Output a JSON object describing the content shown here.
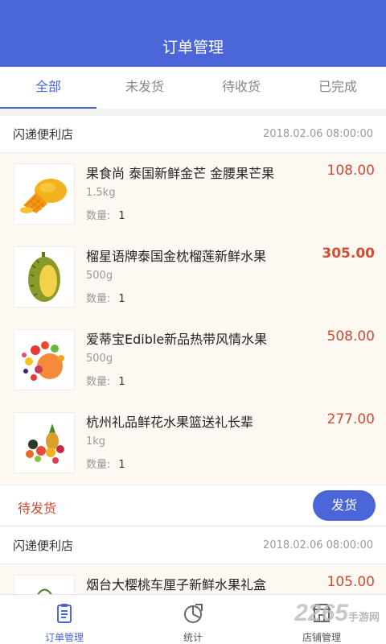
{
  "header": {
    "title": "订单管理"
  },
  "tabs": [
    {
      "label": "全部",
      "active": true
    },
    {
      "label": "未发货",
      "active": false
    },
    {
      "label": "待收货",
      "active": false
    },
    {
      "label": "已完成",
      "active": false
    }
  ],
  "orders": [
    {
      "store": "闪递便利店",
      "time": "2018.02.06 08:00:00",
      "status": "待发货",
      "action": "发货",
      "items": [
        {
          "name": "果食尚 泰国新鲜金芒 金腰果芒果",
          "spec": "1.5kg",
          "qty_label": "数量:",
          "qty": "1",
          "price": "108.00",
          "icon": "mango-image"
        },
        {
          "name": "榴星语牌泰国金枕榴莲新鲜水果",
          "spec": "500g",
          "qty_label": "数量:",
          "qty": "1",
          "price": "305.00",
          "icon": "durian-image"
        },
        {
          "name": "爱蒂宝Edible新品热带风情水果",
          "spec": "500g",
          "qty_label": "数量:",
          "qty": "1",
          "price": "508.00",
          "icon": "fruit-bowl-image"
        },
        {
          "name": "杭州礼品鲜花水果篮送礼长辈",
          "spec": "1kg",
          "qty_label": "数量:",
          "qty": "1",
          "price": "277.00",
          "icon": "fruit-basket-image"
        }
      ]
    },
    {
      "store": "闪递便利店",
      "time": "2018.02.06 08:00:00",
      "items": [
        {
          "name": "烟台大樱桃车厘子新鲜水果礼盒",
          "price": "105.00",
          "icon": "cherry-image"
        }
      ]
    }
  ],
  "bottom_nav": [
    {
      "label": "订单管理",
      "icon": "clipboard-icon",
      "active": true
    },
    {
      "label": "统计",
      "icon": "chart-icon",
      "active": false
    },
    {
      "label": "店铺管理",
      "icon": "store-icon",
      "active": false
    }
  ],
  "watermark": {
    "text": "2265",
    "sub": "手游网"
  },
  "colors": {
    "primary": "#4a66d8",
    "price": "#d24b32",
    "item_bg": "#fdf8f2"
  }
}
